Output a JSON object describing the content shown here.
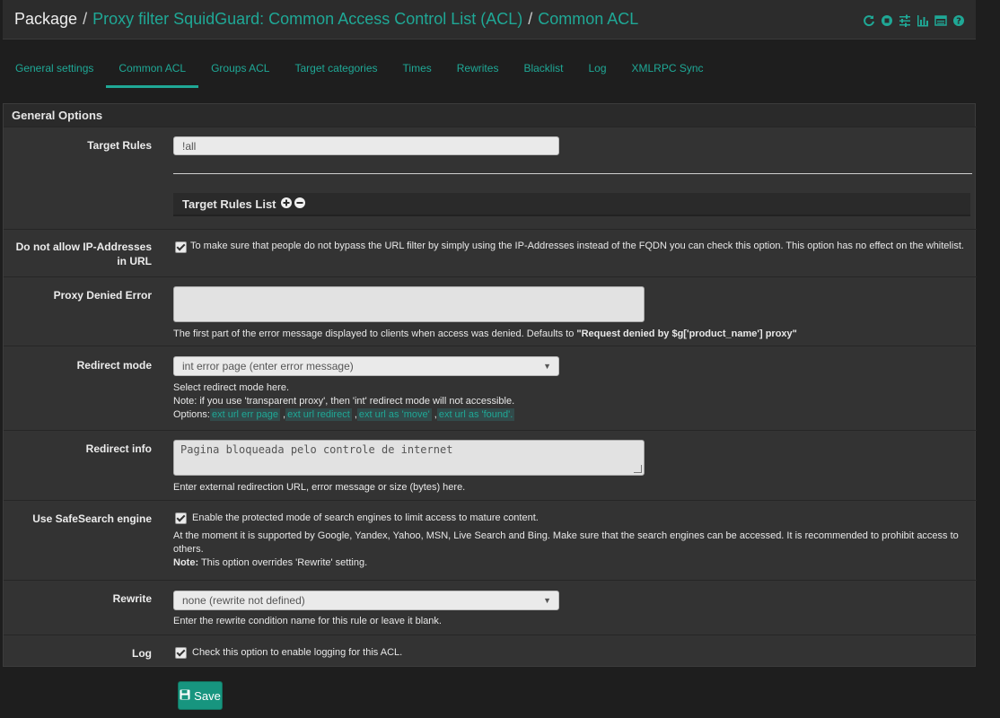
{
  "header": {
    "crumb1": "Package",
    "crumb2": "Proxy filter SquidGuard: Common Access Control List (ACL)",
    "crumb3": "Common ACL",
    "sep": "/"
  },
  "tabs": [
    {
      "label": "General settings",
      "active": false
    },
    {
      "label": "Common ACL",
      "active": true
    },
    {
      "label": "Groups ACL",
      "active": false
    },
    {
      "label": "Target categories",
      "active": false
    },
    {
      "label": "Times",
      "active": false
    },
    {
      "label": "Rewrites",
      "active": false
    },
    {
      "label": "Blacklist",
      "active": false
    },
    {
      "label": "Log",
      "active": false
    },
    {
      "label": "XMLRPC Sync",
      "active": false
    }
  ],
  "panel": {
    "title": "General Options",
    "target_rules": {
      "label": "Target Rules",
      "value": "!all",
      "list_title": "Target Rules List"
    },
    "ip_addresses": {
      "label": "Do not allow IP-Addresses in URL",
      "checked": true,
      "help": "To make sure that people do not bypass the URL filter by simply using the IP-Addresses instead of the FQDN you can check this option. This option has no effect on the whitelist."
    },
    "proxy_denied": {
      "label": "Proxy Denied Error",
      "value": "",
      "help_prefix": "The first part of the error message displayed to clients when access was denied. Defaults to ",
      "help_bold": "\"Request denied by $g['product_name'] proxy\""
    },
    "redirect_mode": {
      "label": "Redirect mode",
      "value": "int error page (enter error message)",
      "help1": "Select redirect mode here.",
      "help2": "Note: if you use 'transparent proxy', then 'int' redirect mode will not accessible.",
      "options_label": "Options:",
      "options": [
        "ext url err page",
        "ext url redirect",
        "ext url as 'move'",
        "ext url as 'found'."
      ],
      "comma": ","
    },
    "redirect_info": {
      "label": "Redirect info",
      "value": "Pagina bloqueada pelo controle de internet",
      "help": "Enter external redirection URL, error message or size (bytes) here."
    },
    "safesearch": {
      "label": "Use SafeSearch engine",
      "checked": true,
      "checkbox_text": "Enable the protected mode of search engines to limit access to mature content.",
      "help": "At the moment it is supported by Google, Yandex, Yahoo, MSN, Live Search and Bing. Make sure that the search engines can be accessed. It is recommended to prohibit access to others.",
      "note_bold": "Note:",
      "note": " This option overrides 'Rewrite' setting."
    },
    "rewrite": {
      "label": "Rewrite",
      "value": "none (rewrite not defined)",
      "help": "Enter the rewrite condition name for this rule or leave it blank."
    },
    "log": {
      "label": "Log",
      "checked": true,
      "checkbox_text": "Check this option to enable logging for this ACL."
    }
  },
  "save_label": "Save",
  "icons": [
    "refresh-icon",
    "stop-icon",
    "settings-icon",
    "chart-icon",
    "list-icon",
    "help-icon"
  ],
  "colors": {
    "accent": "#1fa896",
    "background": "#1e1e1e",
    "panel": "#333333",
    "save": "#17957f"
  }
}
